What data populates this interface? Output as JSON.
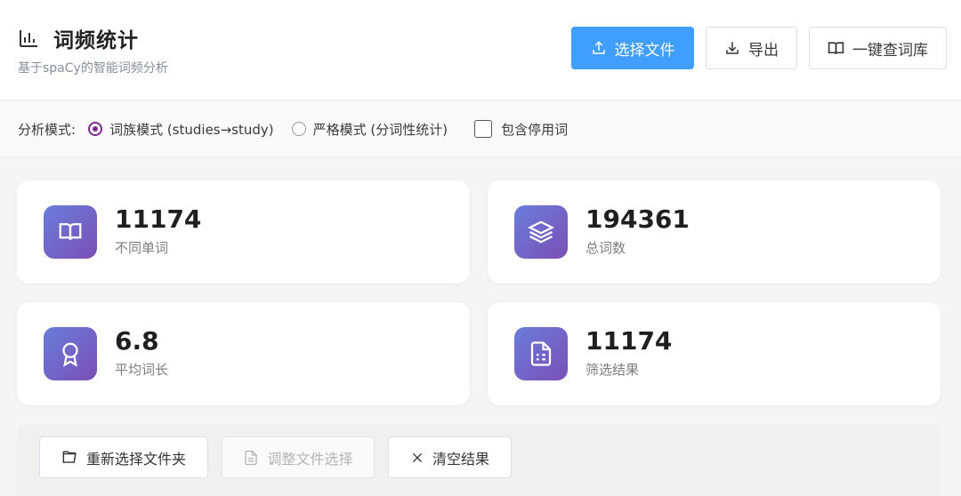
{
  "header": {
    "title": "词频统计",
    "subtitle": "基于spaCy的智能词频分析",
    "buttons": {
      "select_file": "选择文件",
      "export": "导出",
      "lookup": "一键查词库"
    }
  },
  "mode_bar": {
    "label": "分析模式:",
    "options": [
      {
        "label": "词族模式 (studies→study)",
        "checked": true
      },
      {
        "label": "严格模式 (分词性统计)",
        "checked": false
      }
    ],
    "include_stopwords": {
      "label": "包含停用词",
      "checked": false
    }
  },
  "stats": [
    {
      "value": "11174",
      "label": "不同单词",
      "icon": "book-icon"
    },
    {
      "value": "194361",
      "label": "总词数",
      "icon": "layers-icon"
    },
    {
      "value": "6.8",
      "label": "平均词长",
      "icon": "award-icon"
    },
    {
      "value": "11174",
      "label": "筛选结果",
      "icon": "document-icon"
    }
  ],
  "actions": {
    "reselect": "重新选择文件夹",
    "adjust": "调整文件选择",
    "clear": "清空结果"
  },
  "colors": {
    "primary": "#409eff",
    "radio_accent": "#7b2a8c",
    "icon_gradient_start": "#6a7ddb",
    "icon_gradient_end": "#7a4fb4"
  }
}
